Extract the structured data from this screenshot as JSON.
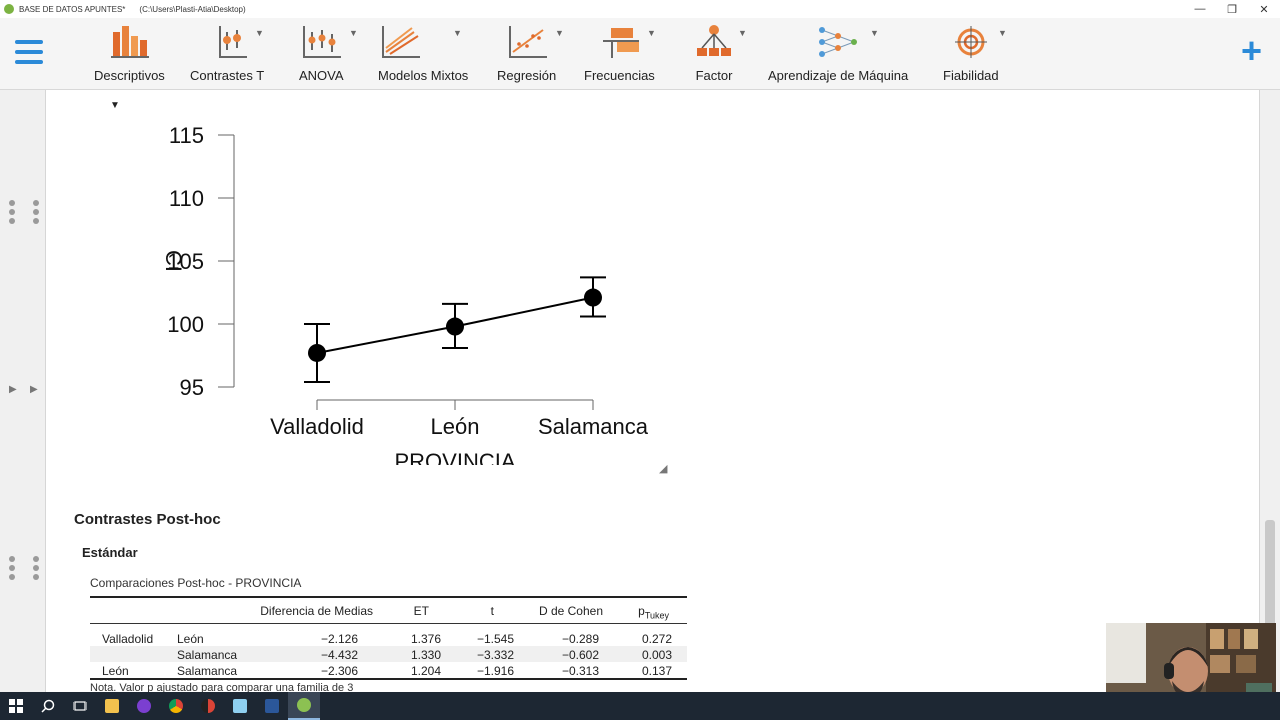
{
  "window": {
    "title": "BASE DE DATOS APUNTES*",
    "path": "(C:\\Users\\Plasti-Atia\\Desktop)",
    "controls": [
      "—",
      "❐",
      "✕"
    ]
  },
  "ribbon": {
    "items": [
      {
        "label": "Descriptivos",
        "icon": "descriptives-bar-icon"
      },
      {
        "label": "Contrastes T",
        "icon": "t-test-icon"
      },
      {
        "label": "ANOVA",
        "icon": "anova-icon"
      },
      {
        "label": "Modelos Mixtos",
        "icon": "mixed-models-icon"
      },
      {
        "label": "Regresión",
        "icon": "regression-icon"
      },
      {
        "label": "Frecuencias",
        "icon": "frequencies-icon"
      },
      {
        "label": "Factor",
        "icon": "factor-icon"
      },
      {
        "label": "Aprendizaje de Máquina",
        "icon": "machine-learning-icon"
      },
      {
        "label": "Fiabilidad",
        "icon": "reliability-icon"
      }
    ],
    "plus": "+"
  },
  "chart_data": {
    "type": "line",
    "categories": [
      "Valladolid",
      "León",
      "Salamanca"
    ],
    "values": [
      97.7,
      99.8,
      102.1
    ],
    "ci_lower": [
      95.4,
      98.1,
      100.6
    ],
    "ci_upper": [
      100.0,
      101.6,
      103.7
    ],
    "title": "",
    "xlabel": "PROVINCIA",
    "ylabel": "CI",
    "ylim": [
      95,
      115
    ],
    "yticks": [
      95,
      100,
      105,
      110,
      115
    ],
    "grid": false,
    "colors": {
      "line": "#000000",
      "marker": "#000000"
    }
  },
  "results": {
    "section_title": "Contrastes Post-hoc",
    "subsection_title": "Estándar",
    "table_title": "Comparaciones Post-hoc - PROVINCIA",
    "columns": [
      "",
      "",
      "Diferencia de Medias",
      "ET",
      "t",
      "D de Cohen",
      "p"
    ],
    "p_subscript": "Tukey",
    "rows": [
      {
        "g1": "Valladolid",
        "g2": "León",
        "diff": "−2.126",
        "se": "1.376",
        "t": "−1.545",
        "d": "−0.289",
        "p": "0.272"
      },
      {
        "g1": "",
        "g2": "Salamanca",
        "diff": "−4.432",
        "se": "1.330",
        "t": "−3.332",
        "d": "−0.602",
        "p": "0.003"
      },
      {
        "g1": "León",
        "g2": "Salamanca",
        "diff": "−2.306",
        "se": "1.204",
        "t": "−1.916",
        "d": "−0.313",
        "p": "0.137"
      }
    ],
    "note_label": "Nota.",
    "note_text": "Valor p ajustado para comparar una familia de 3"
  },
  "taskbar": {
    "icons": [
      "windows-start-icon",
      "search-icon",
      "task-view-icon",
      "file-explorer-icon",
      "media-app-icon",
      "chrome-icon",
      "chrome-alt-icon",
      "app-icon",
      "word-icon",
      "jasp-icon"
    ]
  }
}
